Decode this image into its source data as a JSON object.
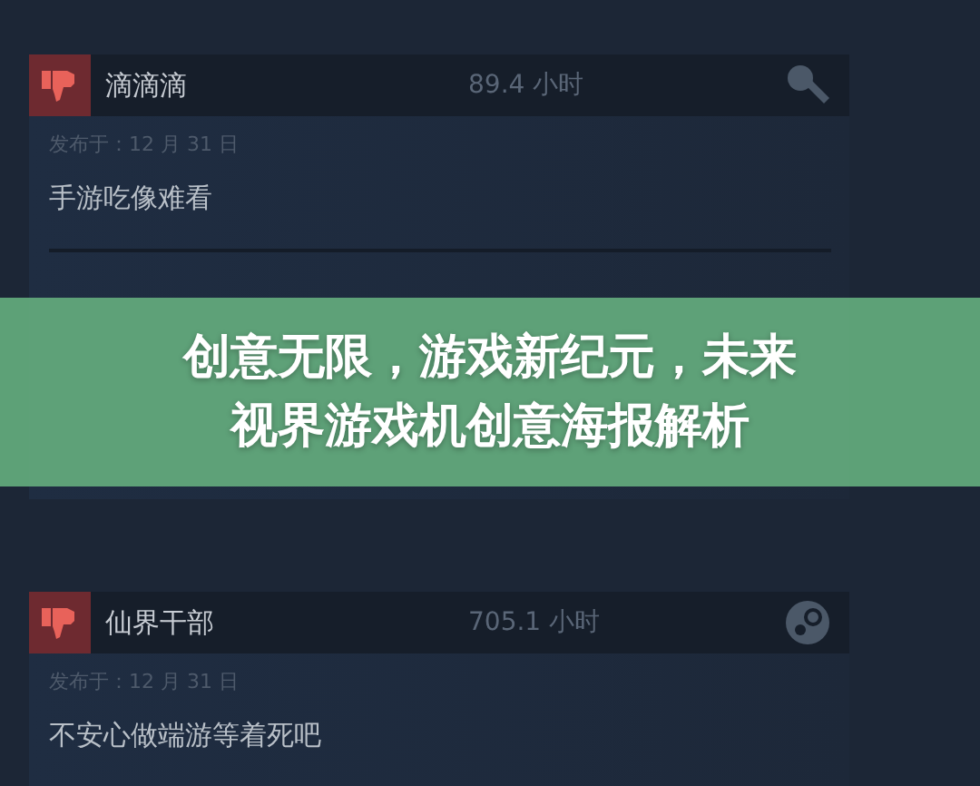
{
  "reviews": [
    {
      "recommended": false,
      "author": "滴滴滴",
      "hours": "89.4 小时",
      "kind": "key",
      "posted": "发布于：12 月 31 日",
      "text": "手游吃像难看"
    },
    {
      "recommended": false,
      "author": "仙界干部",
      "hours": "705.1 小时",
      "kind": "steam",
      "posted": "发布于：12 月 31 日",
      "text": "不安心做端游等着死吧"
    }
  ],
  "banner": {
    "lines": [
      "创意无限，游戏新纪元，未来",
      "视界游戏机创意海报解析"
    ]
  }
}
